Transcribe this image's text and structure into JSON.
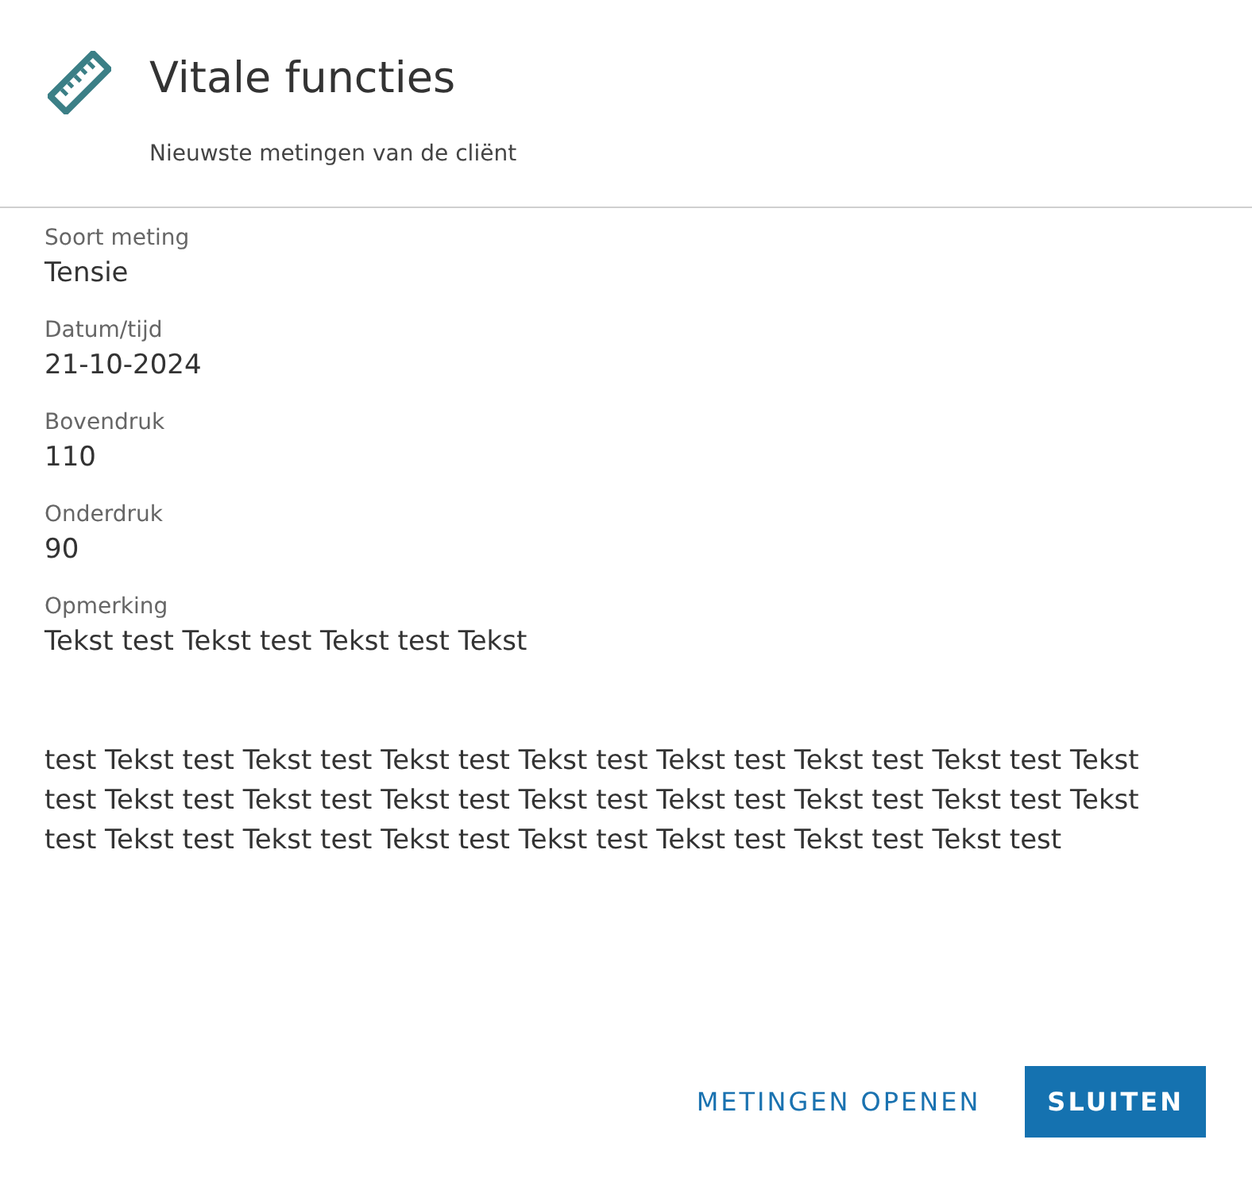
{
  "dialog": {
    "title": "Vitale functies",
    "subtitle": "Nieuwste metingen van de cliënt"
  },
  "fields": [
    {
      "label": "Soort meting",
      "value": "Tensie"
    },
    {
      "label": "Datum/tijd",
      "value": "21-10-2024"
    },
    {
      "label": "Bovendruk",
      "value": "110"
    },
    {
      "label": "Onderdruk",
      "value": "90"
    },
    {
      "label": "Opmerking",
      "value": "Tekst test Tekst test Tekst test Tekst\n\n\ntest Tekst test Tekst test Tekst test Tekst test Tekst test Tekst test Tekst test Tekst test Tekst test Tekst test Tekst test Tekst test Tekst test Tekst test Tekst test Tekst test Tekst test Tekst test Tekst test Tekst test Tekst test Tekst test Tekst test"
    }
  ],
  "buttons": [
    {
      "label": "METINGEN OPENEN",
      "kind": "text"
    },
    {
      "label": "SLUITEN",
      "kind": "primary"
    }
  ]
}
